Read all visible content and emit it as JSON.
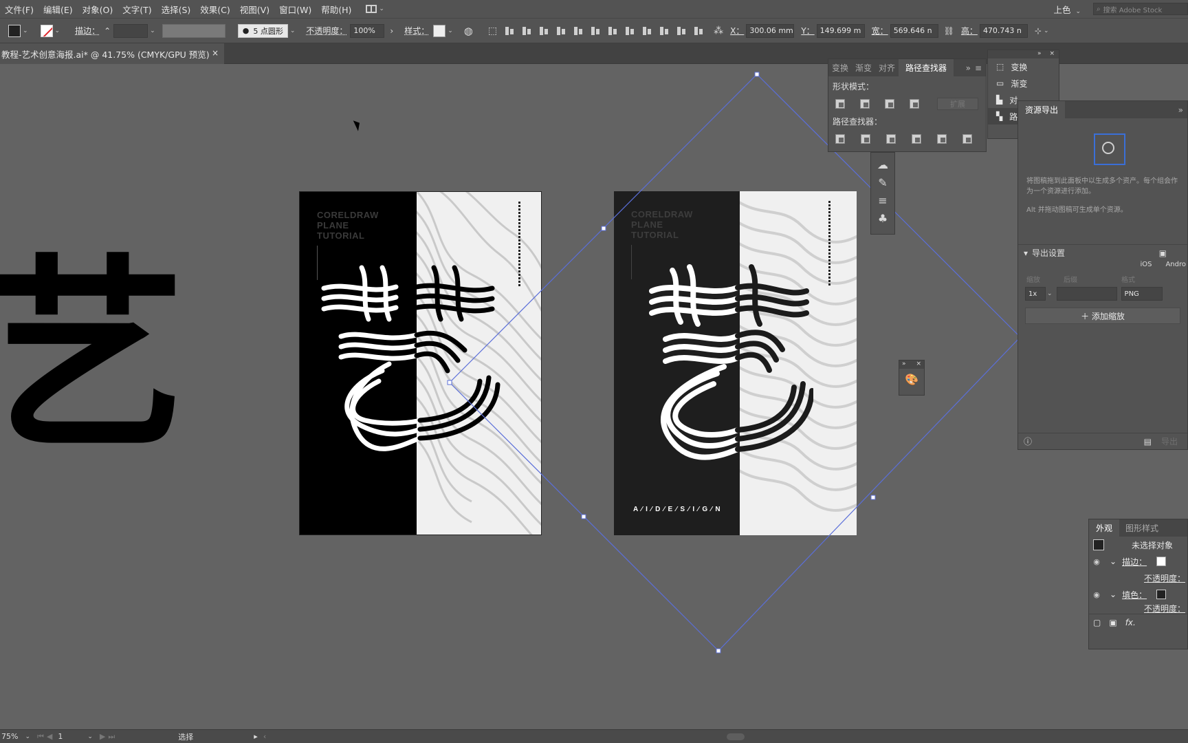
{
  "menu": {
    "items": [
      "文件(F)",
      "编辑(E)",
      "对象(O)",
      "文字(T)",
      "选择(S)",
      "效果(C)",
      "视图(V)",
      "窗口(W)",
      "帮助(H)"
    ],
    "workspace": "上色",
    "search_placeholder": "搜索 Adobe Stock"
  },
  "control": {
    "stroke_label": "描边：",
    "brush": "5 点圆形",
    "opacity_label": "不透明度：",
    "opacity_value": "100%",
    "style_label": "样式：",
    "x_label": "X：",
    "x_value": "300.06 mm",
    "y_label": "Y：",
    "y_value": "149.699 m",
    "w_label": "宽：",
    "w_value": "569.646 n",
    "h_label": "高：",
    "h_value": "470.743 n"
  },
  "document": {
    "tab_title": "教程-艺术创意海报.ai* @ 41.75% (CMYK/GPU 预览)",
    "close": "×"
  },
  "artboards": {
    "heading": [
      "CORELDRAW",
      "PLANE",
      "TUTORIAL"
    ],
    "bottom_text": "A ⁄ I ⁄ D ⁄ E ⁄ S ⁄ I ⁄ G ⁄ N",
    "glyph": "艺",
    "colors": {
      "black": "#000000",
      "dark": "#1e1e1e",
      "light": "#f0f0f0"
    }
  },
  "pathfinder_panel": {
    "tabs": [
      "变换",
      "渐变",
      "对齐",
      "路径查找器"
    ],
    "active_tab": "路径查找器",
    "shape_modes_label": "形状模式：",
    "expand_button": "扩展",
    "pathfinders_label": "路径查找器："
  },
  "mini_panel": {
    "items": [
      "变换",
      "渐变",
      "对",
      "路"
    ]
  },
  "asset_export": {
    "title": "资源导出",
    "description": "将图稿拖到此面板中以生成多个资产。每个组会作为一个资源进行添加。",
    "alt_hint": "Alt 并拖动图稿可生成单个资源。",
    "export_settings": "导出设置",
    "platforms": [
      "iOS",
      "Andro"
    ],
    "col_labels": [
      "缩放",
      "后缀",
      "格式"
    ],
    "scale": "1x",
    "format": "PNG",
    "add_scale": "添加缩放",
    "export_button": "导出"
  },
  "appearance": {
    "tabs": [
      "外观",
      "图形样式"
    ],
    "title": "未选择对象",
    "stroke_label": "描边：",
    "opacity_label": "不透明度：",
    "fill_label": "填色：",
    "fx_label": "fx."
  },
  "status": {
    "zoom": "75%",
    "artboard_num": "1",
    "tool": "选择"
  }
}
